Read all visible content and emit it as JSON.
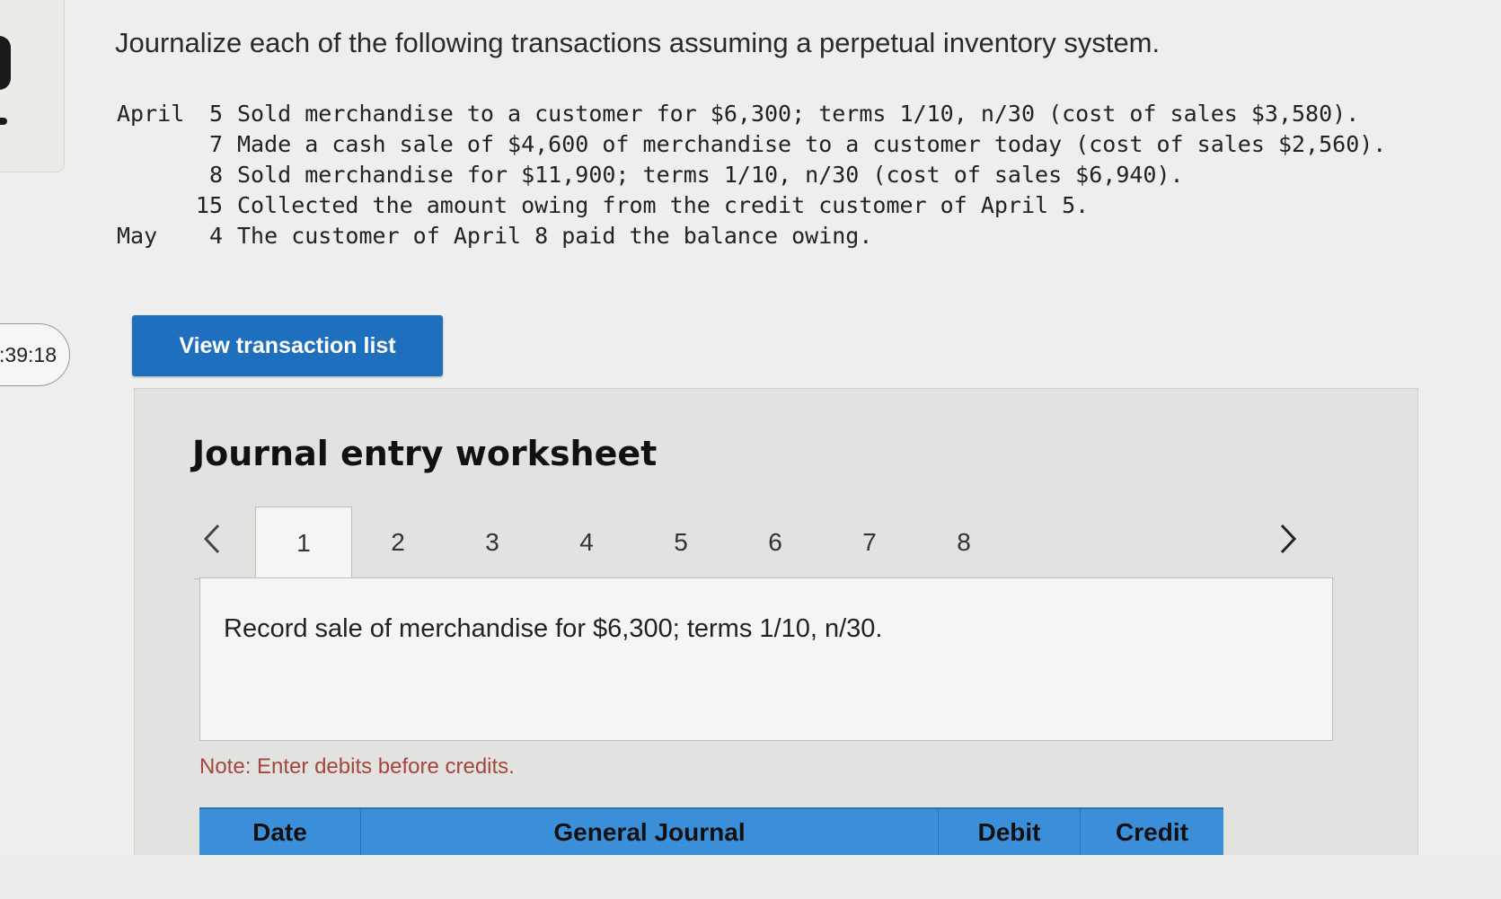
{
  "timer": {
    "text": ":39:18"
  },
  "question": {
    "intro": "Journalize each of the following transactions assuming a perpetual inventory system.",
    "transactions": [
      {
        "month": "April",
        "day": "5",
        "text": "Sold merchandise to a customer for $6,300; terms 1/10, n/30 (cost of sales $3,580)."
      },
      {
        "month": "",
        "day": "7",
        "text": "Made a cash sale of $4,600 of merchandise to a customer today (cost of sales $2,560)."
      },
      {
        "month": "",
        "day": "8",
        "text": "Sold merchandise for $11,900; terms 1/10, n/30 (cost of sales $6,940)."
      },
      {
        "month": "",
        "day": "15",
        "text": "Collected the amount owing from the credit customer of April 5."
      },
      {
        "month": "May",
        "day": "4",
        "text": "The customer of April 8 paid the balance owing."
      }
    ]
  },
  "view_button": {
    "label": "View transaction list"
  },
  "worksheet": {
    "title": "Journal entry worksheet",
    "tabs": [
      "1",
      "2",
      "3",
      "4",
      "5",
      "6",
      "7",
      "8"
    ],
    "active_tab": "1",
    "prompt": "Record sale of merchandise for $6,300; terms 1/10, n/30.",
    "note": "Note: Enter debits before credits.",
    "table_headers": {
      "date": "Date",
      "general_journal": "General Journal",
      "debit": "Debit",
      "credit": "Credit"
    }
  },
  "icons": {
    "prev": "chevron-left-icon",
    "next": "chevron-right-icon"
  },
  "colors": {
    "button": "#1f6fbf",
    "table_header": "#3b8fd9",
    "note": "#a4463c"
  }
}
